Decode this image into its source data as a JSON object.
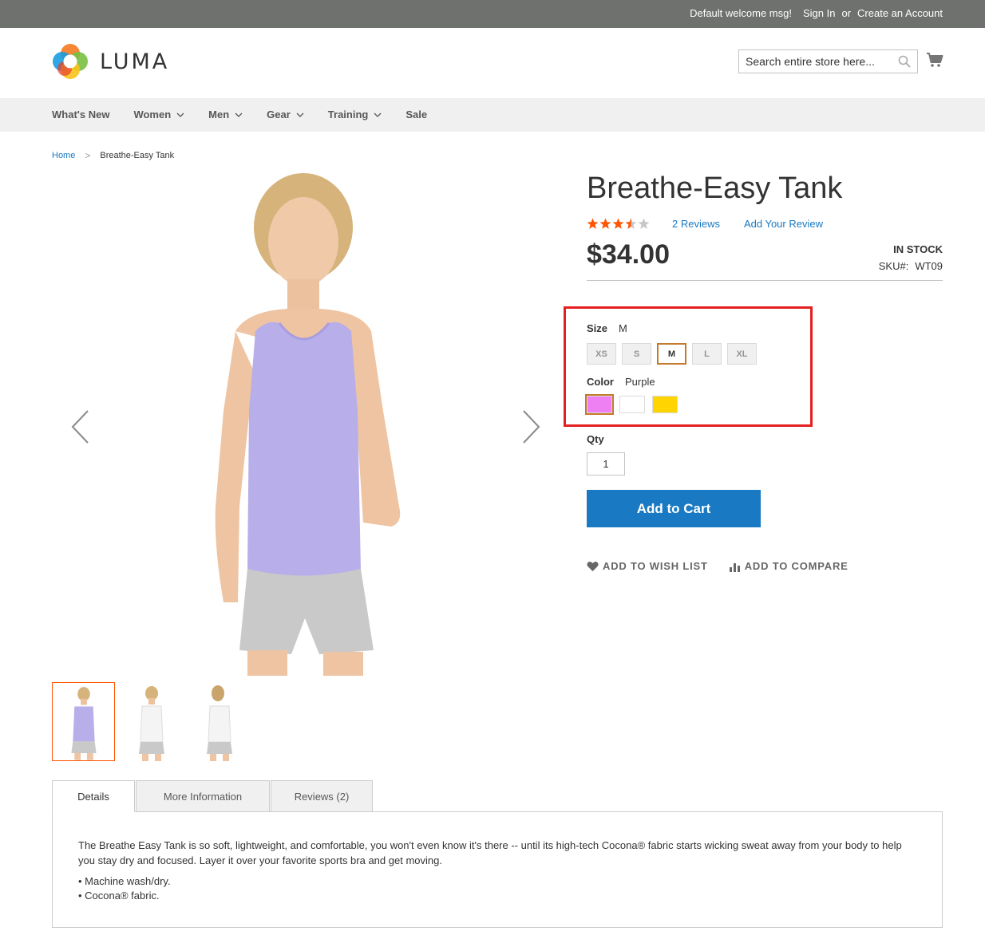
{
  "topbar": {
    "welcome": "Default welcome msg!",
    "sign_in": "Sign In",
    "or": "or",
    "create_account": "Create an Account"
  },
  "header": {
    "logo_text": "LUMA",
    "search_placeholder": "Search entire store here...",
    "cart_icon": "cart-icon",
    "search_icon": "search-icon"
  },
  "nav": {
    "items": [
      {
        "label": "What's New",
        "dropdown": false
      },
      {
        "label": "Women",
        "dropdown": true
      },
      {
        "label": "Men",
        "dropdown": true
      },
      {
        "label": "Gear",
        "dropdown": true
      },
      {
        "label": "Training",
        "dropdown": true
      },
      {
        "label": "Sale",
        "dropdown": false
      }
    ]
  },
  "breadcrumb": {
    "home": "Home",
    "separator": ">",
    "current": "Breathe-Easy Tank"
  },
  "product": {
    "title": "Breathe-Easy Tank",
    "rating_stars": 3.5,
    "rating_max": 5,
    "reviews_count_label": "2  Reviews",
    "add_review_label": "Add Your Review",
    "price": "$34.00",
    "stock": "IN STOCK",
    "sku_label": "SKU#:",
    "sku_value": "WT09",
    "size": {
      "label": "Size",
      "selected": "M",
      "options": [
        "XS",
        "S",
        "M",
        "L",
        "XL"
      ]
    },
    "color": {
      "label": "Color",
      "selected": "Purple",
      "swatches": [
        {
          "name": "Purple",
          "hex": "#ef80f3",
          "selected": true
        },
        {
          "name": "White",
          "hex": "#ffffff",
          "selected": false
        },
        {
          "name": "Yellow",
          "hex": "#ffd400",
          "selected": false
        }
      ]
    },
    "qty_label": "Qty",
    "qty_value": "1",
    "add_to_cart": "Add to Cart",
    "wish_list": "ADD TO WISH LIST",
    "compare": "ADD TO COMPARE"
  },
  "tabs": {
    "items": [
      "Details",
      "More Information",
      "Reviews (2)"
    ],
    "active": "Details",
    "details_text": "The Breathe Easy Tank is so soft, lightweight, and comfortable, you won't even know it's there -- until its high-tech Cocona® fabric starts wicking sweat away from your body to help you stay dry and focused. Layer it over your favorite sports bra and get moving.",
    "bullets": [
      "• Machine wash/dry.",
      "• Cocona® fabric."
    ]
  },
  "colors": {
    "accent_blue": "#1979c3",
    "topbar_bg": "#6e716e",
    "nav_bg": "#f0f0f0",
    "highlight_red": "#e31f1f",
    "star_orange": "#ff5501"
  }
}
